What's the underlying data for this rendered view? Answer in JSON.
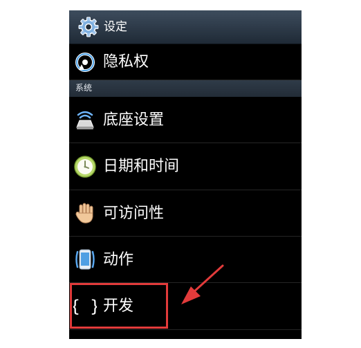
{
  "header": {
    "title": "设定",
    "icon": "settings-gear-icon"
  },
  "items_top": [
    {
      "label": "隐私权",
      "icon": "privacy-sync-icon"
    }
  ],
  "section": {
    "label": "系统"
  },
  "items": [
    {
      "label": "底座设置",
      "icon": "dock-icon"
    },
    {
      "label": "日期和时间",
      "icon": "clock-icon"
    },
    {
      "label": "可访问性",
      "icon": "hand-icon"
    },
    {
      "label": "动作",
      "icon": "phone-motion-icon"
    },
    {
      "label": "开发",
      "icon": "braces-icon"
    }
  ],
  "annotation": {
    "highlight_color": "#e23b3b",
    "arrow_color": "#e23b3b"
  },
  "colors": {
    "background": "#000000",
    "header": "#2c3a49",
    "section_header": "#2a3541",
    "text": "#ffffff"
  }
}
